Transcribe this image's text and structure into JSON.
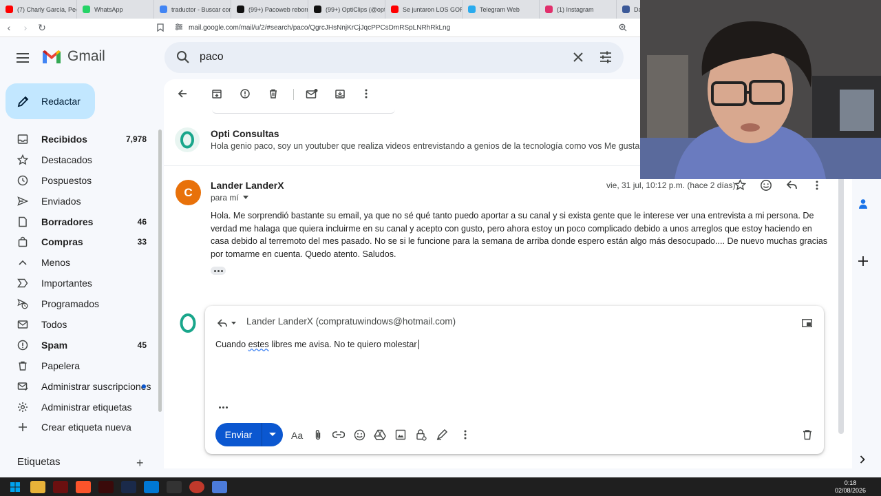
{
  "browser": {
    "tabs": [
      {
        "label": "(7) Charly García, Pedr",
        "color": "#ff0000"
      },
      {
        "label": "WhatsApp",
        "color": "#25d366"
      },
      {
        "label": "traductor - Buscar con",
        "color": "#4285f4"
      },
      {
        "label": "(99+) Pacoweb reborn",
        "color": "#111111"
      },
      {
        "label": "(99+) OptiClips (@opti",
        "color": "#111111"
      },
      {
        "label": "Se juntaron LOS GOR",
        "color": "#ff0000"
      },
      {
        "label": "Telegram Web",
        "color": "#2aabee"
      },
      {
        "label": "(1) Instagram",
        "color": "#e1306c"
      },
      {
        "label": "Da",
        "color": "#3b5998"
      }
    ],
    "url": "mail.google.com/mail/u/2/#search/paco/QgrcJHsNnjKrCjJqcPPCsDmRSpLNRhRkLng"
  },
  "gmail": {
    "logo_text": "Gmail",
    "search_value": "paco",
    "compose_label": "Redactar",
    "nav": [
      {
        "label": "Recibidos",
        "count": "7,978",
        "bold": true,
        "icon": "inbox-icon"
      },
      {
        "label": "Destacados",
        "count": "",
        "bold": false,
        "icon": "star-icon"
      },
      {
        "label": "Pospuestos",
        "count": "",
        "bold": false,
        "icon": "clock-icon"
      },
      {
        "label": "Enviados",
        "count": "",
        "bold": false,
        "icon": "send-icon"
      },
      {
        "label": "Borradores",
        "count": "46",
        "bold": true,
        "icon": "draft-icon"
      },
      {
        "label": "Compras",
        "count": "33",
        "bold": true,
        "icon": "shopping-bag-icon"
      },
      {
        "label": "Menos",
        "count": "",
        "bold": false,
        "icon": "chevron-up-icon"
      },
      {
        "label": "Importantes",
        "count": "",
        "bold": false,
        "icon": "important-icon"
      },
      {
        "label": "Programados",
        "count": "",
        "bold": false,
        "icon": "scheduled-icon"
      },
      {
        "label": "Todos",
        "count": "",
        "bold": false,
        "icon": "all-mail-icon"
      },
      {
        "label": "Spam",
        "count": "45",
        "bold": true,
        "icon": "spam-icon"
      },
      {
        "label": "Papelera",
        "count": "",
        "bold": false,
        "icon": "trash-icon"
      },
      {
        "label": "Administrar suscripciones",
        "count": "",
        "bold": false,
        "icon": "subscriptions-icon"
      },
      {
        "label": "Administrar etiquetas",
        "count": "",
        "bold": false,
        "icon": "gear-icon"
      },
      {
        "label": "Crear etiqueta nueva",
        "count": "",
        "bold": false,
        "icon": "plus-icon"
      }
    ],
    "labels_header": "Etiquetas"
  },
  "thread": {
    "msg1": {
      "sender": "Opti Consultas",
      "snippet": "Hola genio paco, soy un youtuber que realiza videos entrevistando a genios de la tecnología como vos Me gustaria l"
    },
    "msg2": {
      "avatar_letter": "C",
      "sender": "Lander LanderX",
      "date": "vie, 31 jul, 10:12 p.m. (hace 2 días)",
      "to": "para mí",
      "body": "Hola. Me sorprendió bastante su email, ya que no sé qué tanto puedo aportar a su canal y si exista gente que le interese ver una entrevista a mi persona. De verdad me halaga que quiera incluirme en su canal y acepto con gusto, pero ahora estoy un poco complicado debido a unos arreglos que estoy haciendo en casa debido al terremoto del mes pasado. No se si le funcione para la semana de arriba donde espero están algo más desocupado.... De nuevo muchas gracias por tomarme en cuenta. Quedo atento. Saludos."
    },
    "reply": {
      "to": "Lander LanderX (compratuwindows@hotmail.com)",
      "text_before": "Cuando ",
      "text_misspelled": "estes",
      "text_after": " libres me avisa. No te quiero molestar",
      "send_label": "Enviar"
    }
  },
  "taskbar": {
    "time": "0:18",
    "date": "02/08/2026"
  },
  "colors": {
    "accent": "#0b57d0",
    "compose_bg": "#c2e7ff",
    "avatar_c": "#e8710a"
  }
}
